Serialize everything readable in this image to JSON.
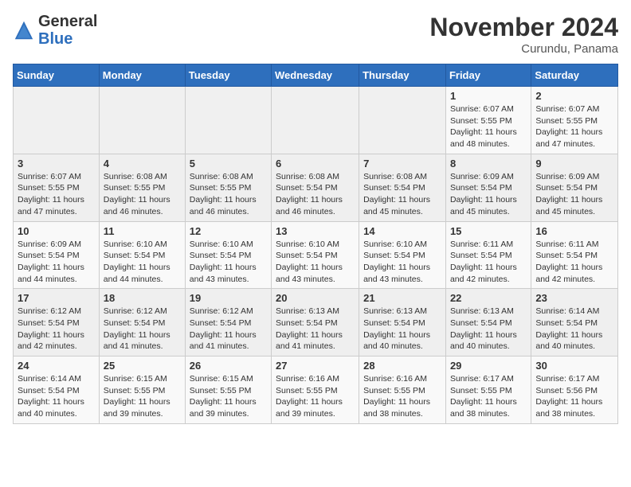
{
  "logo": {
    "general": "General",
    "blue": "Blue"
  },
  "header": {
    "month": "November 2024",
    "location": "Curundu, Panama"
  },
  "weekdays": [
    "Sunday",
    "Monday",
    "Tuesday",
    "Wednesday",
    "Thursday",
    "Friday",
    "Saturday"
  ],
  "weeks": [
    [
      {
        "day": "",
        "info": ""
      },
      {
        "day": "",
        "info": ""
      },
      {
        "day": "",
        "info": ""
      },
      {
        "day": "",
        "info": ""
      },
      {
        "day": "",
        "info": ""
      },
      {
        "day": "1",
        "info": "Sunrise: 6:07 AM\nSunset: 5:55 PM\nDaylight: 11 hours and 48 minutes."
      },
      {
        "day": "2",
        "info": "Sunrise: 6:07 AM\nSunset: 5:55 PM\nDaylight: 11 hours and 47 minutes."
      }
    ],
    [
      {
        "day": "3",
        "info": "Sunrise: 6:07 AM\nSunset: 5:55 PM\nDaylight: 11 hours and 47 minutes."
      },
      {
        "day": "4",
        "info": "Sunrise: 6:08 AM\nSunset: 5:55 PM\nDaylight: 11 hours and 46 minutes."
      },
      {
        "day": "5",
        "info": "Sunrise: 6:08 AM\nSunset: 5:55 PM\nDaylight: 11 hours and 46 minutes."
      },
      {
        "day": "6",
        "info": "Sunrise: 6:08 AM\nSunset: 5:54 PM\nDaylight: 11 hours and 46 minutes."
      },
      {
        "day": "7",
        "info": "Sunrise: 6:08 AM\nSunset: 5:54 PM\nDaylight: 11 hours and 45 minutes."
      },
      {
        "day": "8",
        "info": "Sunrise: 6:09 AM\nSunset: 5:54 PM\nDaylight: 11 hours and 45 minutes."
      },
      {
        "day": "9",
        "info": "Sunrise: 6:09 AM\nSunset: 5:54 PM\nDaylight: 11 hours and 45 minutes."
      }
    ],
    [
      {
        "day": "10",
        "info": "Sunrise: 6:09 AM\nSunset: 5:54 PM\nDaylight: 11 hours and 44 minutes."
      },
      {
        "day": "11",
        "info": "Sunrise: 6:10 AM\nSunset: 5:54 PM\nDaylight: 11 hours and 44 minutes."
      },
      {
        "day": "12",
        "info": "Sunrise: 6:10 AM\nSunset: 5:54 PM\nDaylight: 11 hours and 43 minutes."
      },
      {
        "day": "13",
        "info": "Sunrise: 6:10 AM\nSunset: 5:54 PM\nDaylight: 11 hours and 43 minutes."
      },
      {
        "day": "14",
        "info": "Sunrise: 6:10 AM\nSunset: 5:54 PM\nDaylight: 11 hours and 43 minutes."
      },
      {
        "day": "15",
        "info": "Sunrise: 6:11 AM\nSunset: 5:54 PM\nDaylight: 11 hours and 42 minutes."
      },
      {
        "day": "16",
        "info": "Sunrise: 6:11 AM\nSunset: 5:54 PM\nDaylight: 11 hours and 42 minutes."
      }
    ],
    [
      {
        "day": "17",
        "info": "Sunrise: 6:12 AM\nSunset: 5:54 PM\nDaylight: 11 hours and 42 minutes."
      },
      {
        "day": "18",
        "info": "Sunrise: 6:12 AM\nSunset: 5:54 PM\nDaylight: 11 hours and 41 minutes."
      },
      {
        "day": "19",
        "info": "Sunrise: 6:12 AM\nSunset: 5:54 PM\nDaylight: 11 hours and 41 minutes."
      },
      {
        "day": "20",
        "info": "Sunrise: 6:13 AM\nSunset: 5:54 PM\nDaylight: 11 hours and 41 minutes."
      },
      {
        "day": "21",
        "info": "Sunrise: 6:13 AM\nSunset: 5:54 PM\nDaylight: 11 hours and 40 minutes."
      },
      {
        "day": "22",
        "info": "Sunrise: 6:13 AM\nSunset: 5:54 PM\nDaylight: 11 hours and 40 minutes."
      },
      {
        "day": "23",
        "info": "Sunrise: 6:14 AM\nSunset: 5:54 PM\nDaylight: 11 hours and 40 minutes."
      }
    ],
    [
      {
        "day": "24",
        "info": "Sunrise: 6:14 AM\nSunset: 5:54 PM\nDaylight: 11 hours and 40 minutes."
      },
      {
        "day": "25",
        "info": "Sunrise: 6:15 AM\nSunset: 5:55 PM\nDaylight: 11 hours and 39 minutes."
      },
      {
        "day": "26",
        "info": "Sunrise: 6:15 AM\nSunset: 5:55 PM\nDaylight: 11 hours and 39 minutes."
      },
      {
        "day": "27",
        "info": "Sunrise: 6:16 AM\nSunset: 5:55 PM\nDaylight: 11 hours and 39 minutes."
      },
      {
        "day": "28",
        "info": "Sunrise: 6:16 AM\nSunset: 5:55 PM\nDaylight: 11 hours and 38 minutes."
      },
      {
        "day": "29",
        "info": "Sunrise: 6:17 AM\nSunset: 5:55 PM\nDaylight: 11 hours and 38 minutes."
      },
      {
        "day": "30",
        "info": "Sunrise: 6:17 AM\nSunset: 5:56 PM\nDaylight: 11 hours and 38 minutes."
      }
    ]
  ]
}
